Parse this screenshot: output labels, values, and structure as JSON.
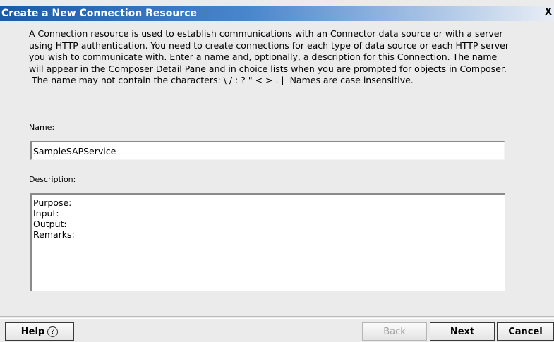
{
  "dialog": {
    "title": "Create a New Connection Resource",
    "close_label": "X",
    "intro_lines": [
      "A Connection resource is used to establish communications with an Connector data source or with a server",
      "using HTTP authentication. You need to create connections for each type of data source or each HTTP server",
      "you wish to communicate with.  Enter a name and, optionally, a description for this Connection.  The name",
      "will appear in the Composer Detail Pane and in choice lists when you are prompted for objects in Composer.",
      " The name may not contain the characters: \\ / : ? \" < > . |  Names are case insensitive."
    ]
  },
  "form": {
    "name_label": "Name:",
    "name_value": "SampleSAPService",
    "description_label": "Description:",
    "description_value": "Purpose:\nInput:\nOutput:\nRemarks:"
  },
  "buttons": {
    "help": "Help",
    "help_icon": "?",
    "back": "Back",
    "next": "Next",
    "cancel": "Cancel"
  },
  "colors": {
    "titlebar_start": "#1c5aa8",
    "titlebar_end": "#e9eef6",
    "background": "#ebebeb"
  }
}
